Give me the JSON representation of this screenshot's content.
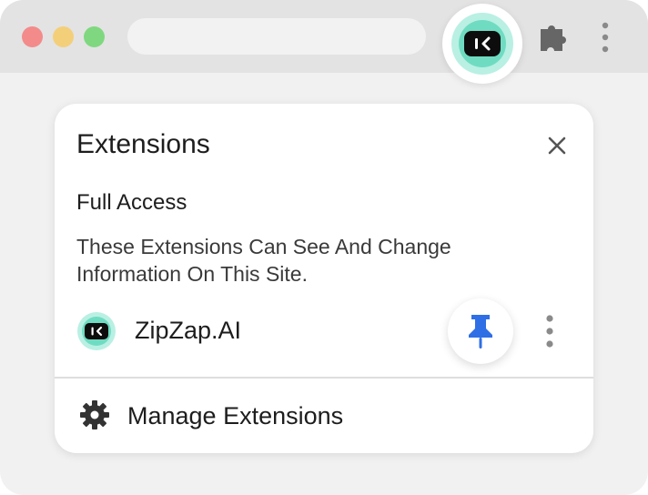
{
  "browser": {
    "traffic_lights": [
      "close",
      "minimize",
      "maximize"
    ],
    "address_bar_value": "",
    "toolbar_icons": [
      "zipzap-extension-icon",
      "puzzle-icon",
      "more-vert-icon"
    ]
  },
  "popup": {
    "title": "Extensions",
    "section": {
      "heading": "Full Access",
      "description": "These Extensions Can See And Change Information On This Site."
    },
    "extensions": [
      {
        "name": "ZipZap.AI",
        "icon": "zipzap-logo-icon",
        "pinned": true
      }
    ],
    "footer": {
      "label": "Manage Extensions",
      "icon": "gear-icon"
    }
  },
  "colors": {
    "accent_pin": "#2f6fe6",
    "logo_teal": "#6fdcc2",
    "logo_dark": "#0d0d0d",
    "titlebar": "#e3e3e3",
    "window_bg": "#f1f1f1"
  }
}
